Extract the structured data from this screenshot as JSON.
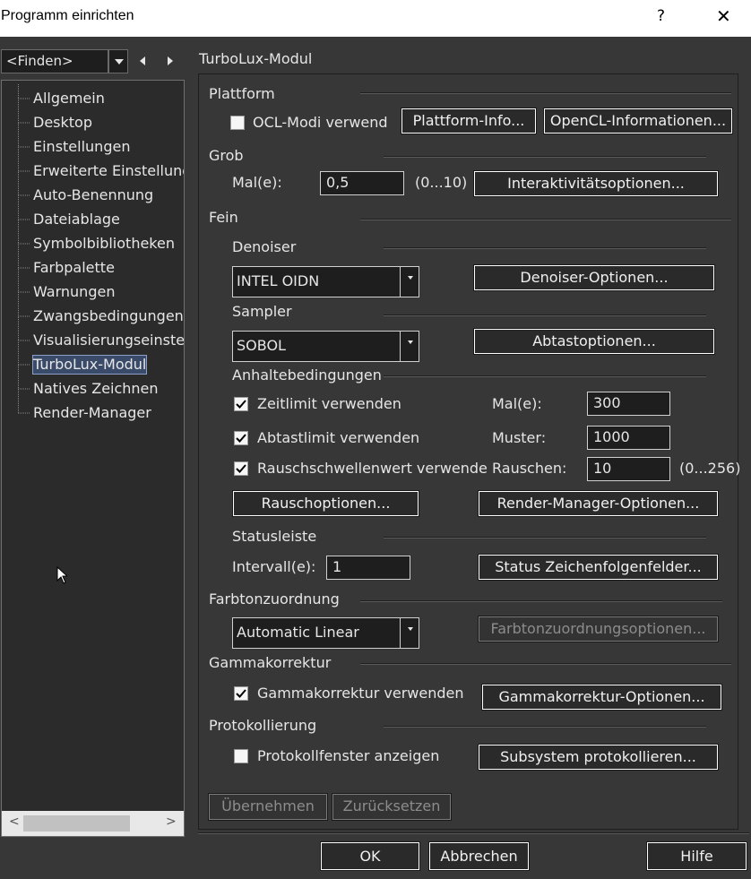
{
  "window": {
    "title": "Programm einrichten",
    "help": "?",
    "close": "✕"
  },
  "finder": {
    "value": "<Finden>"
  },
  "tree": {
    "items": [
      "Allgemein",
      "Desktop",
      "Einstellungen",
      "Erweiterte Einstellung",
      "Auto-Benennung",
      "Dateiablage",
      "Symbolbibliotheken",
      "Farbpalette",
      "Warnungen",
      "Zwangsbedingungen",
      "Visualisierungseinste",
      "TurboLux-Modul",
      "Natives Zeichnen",
      "Render-Manager"
    ],
    "selected": "TurboLux-Modul",
    "scroll_left": "<",
    "scroll_right": ">"
  },
  "panel": {
    "title": "TurboLux-Modul",
    "plattform": {
      "heading": "Plattform",
      "ocl_label": "OCL-Modi verwend",
      "ocl_checked": false,
      "plattform_info": "Plattform-Info...",
      "opencl_info": "OpenCL-Informationen..."
    },
    "grob": {
      "heading": "Grob",
      "mal_label": "Mal(e):",
      "mal_value": "0,5",
      "range": "(0...10)",
      "interaktiv": "Interaktivitätsoptionen..."
    },
    "fein": {
      "heading": "Fein",
      "denoiser_heading": "Denoiser",
      "denoiser_value": "INTEL OIDN",
      "denoiser_btn": "Denoiser-Optionen...",
      "sampler_heading": "Sampler",
      "sampler_value": "SOBOL",
      "sampler_btn": "Abtastoptionen...",
      "anhalte_heading": "Anhaltebedingungen",
      "zeit_label": "Zeitlimit verwenden",
      "zeit_checked": true,
      "abtast_label": "Abtastlimit verwenden",
      "abtast_checked": true,
      "rausch_label": "Rauschschwellenwert verwende",
      "rausch_checked": true,
      "male_label": "Mal(e):",
      "male_value": "300",
      "muster_label": "Muster:",
      "muster_value": "1000",
      "rauschen_label": "Rauschen:",
      "rauschen_value": "10",
      "rauschen_range": "(0...256)",
      "rausch_btn": "Rauschoptionen...",
      "render_btn": "Render-Manager-Optionen...",
      "status_heading": "Statusleiste",
      "intervall_label": "Intervall(e):",
      "intervall_value": "1",
      "status_btn": "Status Zeichenfolgenfelder..."
    },
    "farbton": {
      "heading": "Farbtonzuordnung",
      "value": "Automatic Linear",
      "btn": "Farbtonzuordnungsoptionen..."
    },
    "gamma": {
      "heading": "Gammakorrektur",
      "label": "Gammakorrektur verwenden",
      "checked": true,
      "btn": "Gammakorrektur-Optionen..."
    },
    "proto": {
      "heading": "Protokollierung",
      "label": "Protokollfenster anzeigen",
      "checked": false,
      "btn": "Subsystem protokollieren..."
    },
    "apply": "Übernehmen",
    "reset": "Zurücksetzen"
  },
  "footer": {
    "ok": "OK",
    "cancel": "Abbrechen",
    "help": "Hilfe"
  }
}
